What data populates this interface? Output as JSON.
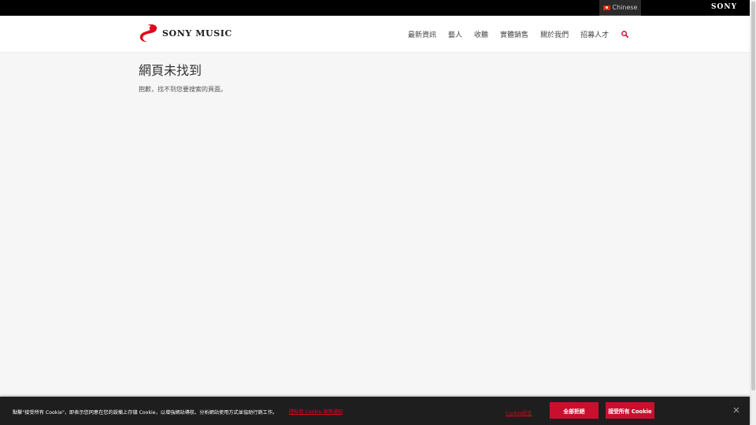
{
  "topbar": {
    "language": "Chinese",
    "brand": "SONY"
  },
  "header": {
    "logo_text": "SONY MUSIC",
    "nav": [
      {
        "label": "最新資訊"
      },
      {
        "label": "藝人"
      },
      {
        "label": "收聽"
      },
      {
        "label": "實體銷售"
      },
      {
        "label": "關於我們"
      },
      {
        "label": "招募人才"
      }
    ]
  },
  "main": {
    "title": "網頁未找到",
    "message": "抱歉，找不到您要搜索的頁面。"
  },
  "cookie": {
    "text": "點擊\"接受所有 Cookie\"，即表示您同意在您的設備上存儲 Cookie，以增強網站導航、分析網站使用方式並協助行銷工作。",
    "policy_link": "隱私和 Cookie 政策通知",
    "settings_label": "Cookie設定",
    "reject_label": "全部拒絕",
    "accept_label": "接受所有 Cookie"
  },
  "colors": {
    "accent": "#c8102e",
    "topbar": "#000000",
    "background": "#f6f6f6"
  }
}
